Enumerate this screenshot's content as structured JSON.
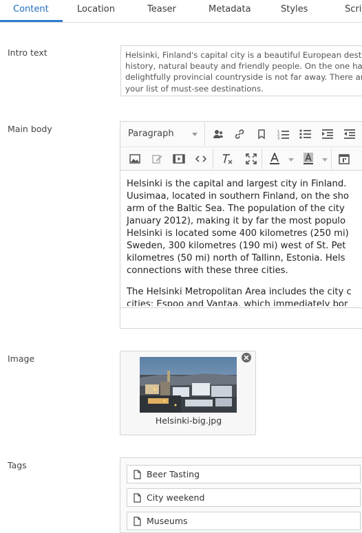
{
  "tabs": [
    "Content",
    "Location",
    "Teaser",
    "Metadata",
    "Styles",
    "Scri"
  ],
  "intro": {
    "label": "Intro text",
    "lines": [
      "Helsinki, Finland's capital city is a beautiful European dest",
      "history, natural beauty and friendly people. On the one han",
      "delightfully provincial countryside is not far away. There ar",
      "your list of must-see destinations."
    ]
  },
  "main_body": {
    "label": "Main body",
    "format_select": "Paragraph",
    "paragraph1": [
      "Helsinki is the capital and largest city in Finland.",
      "Uusimaa, located in southern Finland, on the sho",
      "arm of the Baltic Sea. The population of the city",
      "January 2012), making it by far the most populo",
      "Helsinki is located some 400 kilometres (250 mi)",
      "Sweden, 300 kilometres (190 mi) west of St. Pet",
      "kilometres (50 mi) north of Tallinn, Estonia. Hels",
      "connections with these three cities."
    ],
    "paragraph2": [
      "The Helsinki Metropolitan Area includes the city c",
      "cities: Espoo and Vantaa, which immediately bor"
    ]
  },
  "image": {
    "label": "Image",
    "filename": "Helsinki-big.jpg"
  },
  "tags": {
    "label": "Tags",
    "items": [
      "Beer Tasting",
      "City weekend",
      "Museums"
    ]
  }
}
